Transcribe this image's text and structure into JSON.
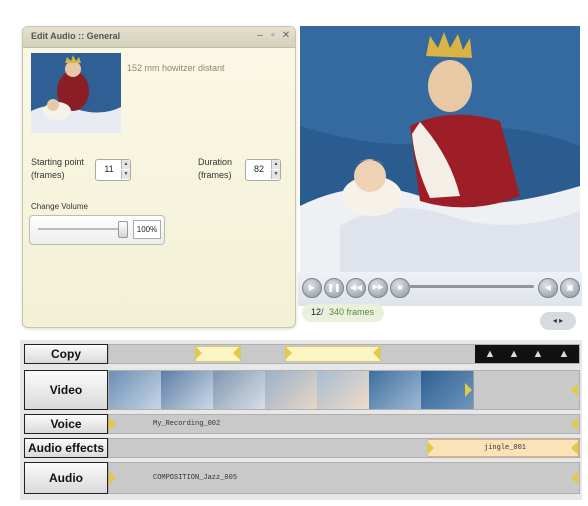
{
  "dialog": {
    "title": "Edit Audio :: General",
    "controls": [
      "–",
      "▫",
      "✕"
    ],
    "clip_name": "152 mm howitzer distant",
    "starting_point_label_1": "Starting point",
    "starting_point_label_2": "(frames)",
    "starting_point_value": "11",
    "duration_label_1": "Duration",
    "duration_label_2": "(frames)",
    "duration_value": "82",
    "change_volume_label": "Change Volume",
    "volume_value": "100%",
    "volume_level_percent": 100
  },
  "player": {
    "buttons": [
      "play-icon",
      "pause-icon",
      "rewind-icon",
      "fast-forward-icon",
      "stop-icon"
    ],
    "seek_level_percent": 97,
    "frame_current": "12",
    "frame_separator": "/",
    "frame_total": "340 frames",
    "scroll_arrows": "◂ ▸"
  },
  "timeline": {
    "tracks": [
      {
        "label": "Copy"
      },
      {
        "label": "Video"
      },
      {
        "label": "Voice",
        "clip": "My_Recording_002"
      },
      {
        "label": "Audio effects",
        "clip": "jingle_001"
      },
      {
        "label": "Audio",
        "clip": "COMPOSITION_Jazz_005"
      }
    ],
    "copy_icons": [
      "▲",
      "▲",
      "▲",
      "▲"
    ]
  },
  "colors": {
    "dialog_bg": "#f3f0d6",
    "copy_segment": "#faf5c2",
    "effect_segment": "#fbe2b8",
    "marker": "#e3c94a",
    "counter_accent": "#5d8a3a"
  }
}
